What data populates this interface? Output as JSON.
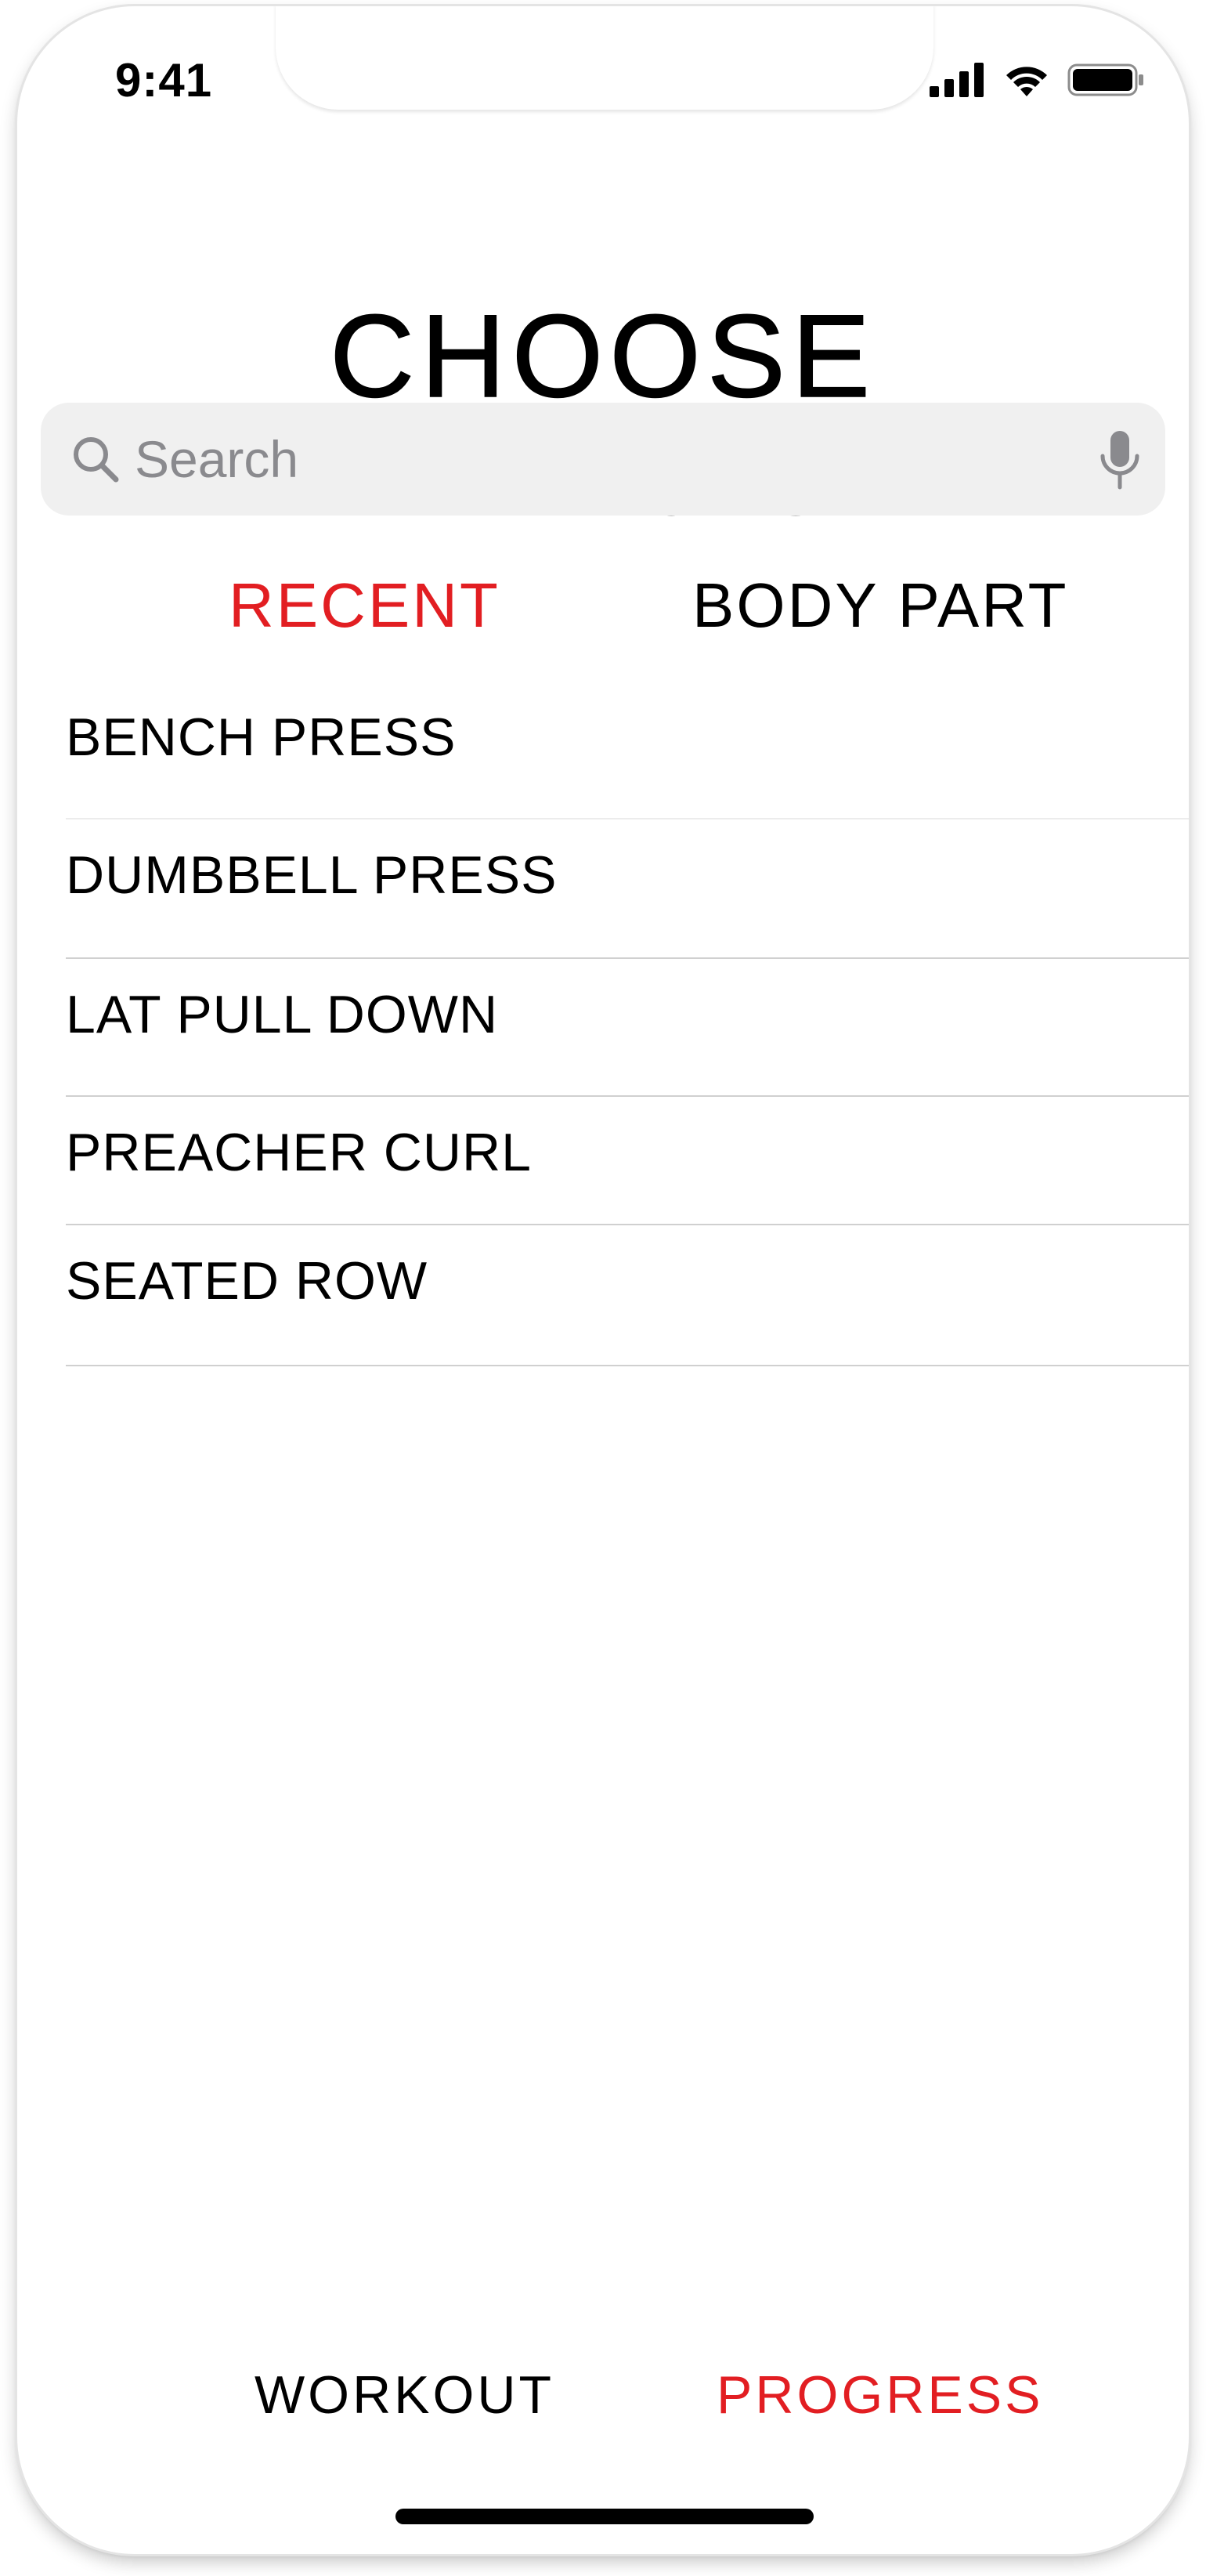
{
  "status_bar": {
    "time": "9:41"
  },
  "page": {
    "title": "CHOOSE EXERCISE"
  },
  "search": {
    "placeholder": "Search",
    "icon": "search-icon",
    "mic_icon": "microphone-icon"
  },
  "tabs": {
    "recent": "RECENT",
    "body_part": "BODY PART",
    "active": "RECENT",
    "active_color": "#e21e22",
    "inactive_color": "#000000"
  },
  "exercises": [
    {
      "label": "BENCH PRESS"
    },
    {
      "label": "DUMBBELL PRESS"
    },
    {
      "label": "LAT PULL DOWN"
    },
    {
      "label": "PREACHER CURL"
    },
    {
      "label": "SEATED ROW"
    }
  ],
  "bottom_nav": {
    "workout": "WORKOUT",
    "progress": "PROGRESS",
    "active": "PROGRESS"
  },
  "colors": {
    "accent": "#e21e22",
    "search_background": "#f0f0f0",
    "placeholder": "#8a8a8e",
    "divider": "#d0d0d0"
  }
}
